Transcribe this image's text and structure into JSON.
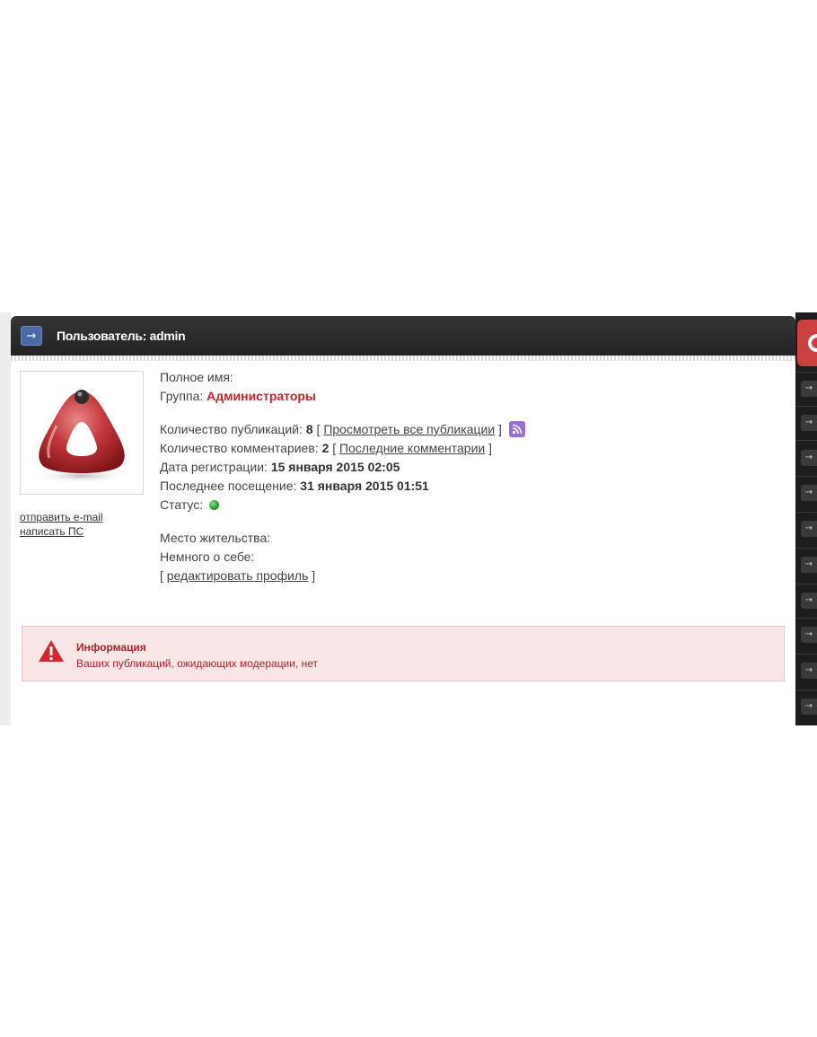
{
  "header": {
    "title": "Пользователь: admin",
    "arrow_icon": "arrow-right-icon"
  },
  "user_links": {
    "email": "отправить e-mail",
    "pm": "написать ПС"
  },
  "profile": {
    "fullname_label": "Полное имя:",
    "group_label": "Группа:",
    "group_value": "Администраторы",
    "pubs_label": "Количество публикаций:",
    "pubs_value": "8",
    "pubs_link": "Просмотреть все публикации",
    "comments_label": "Количество комментариев:",
    "comments_value": "2",
    "comments_link": "Последние комментарии",
    "reg_label": "Дата регистрации:",
    "reg_value": "15 января 2015 02:05",
    "visit_label": "Последнее посещение:",
    "visit_value": "31 января 2015 01:51",
    "status_label": "Статус:",
    "location_label": "Место жительства:",
    "about_label": "Немного о себе:",
    "edit_link": "редактировать профиль",
    "bracket_open": "[",
    "bracket_close": "]"
  },
  "alert": {
    "title": "Информация",
    "text": "Ваших публикаций, ожидающих модерации, нет"
  },
  "colors": {
    "header_bg": "#2b2b2b",
    "group_color": "#c0272d",
    "alert_bg": "#f9e6e6",
    "alert_text": "#a8242a",
    "status_online": "#1f9d25",
    "rss": "#9b6fcf"
  },
  "icons": {
    "rss": "rss-icon",
    "status": "status-online-icon",
    "alert": "warning-icon",
    "avatar": "avatar-logo"
  }
}
